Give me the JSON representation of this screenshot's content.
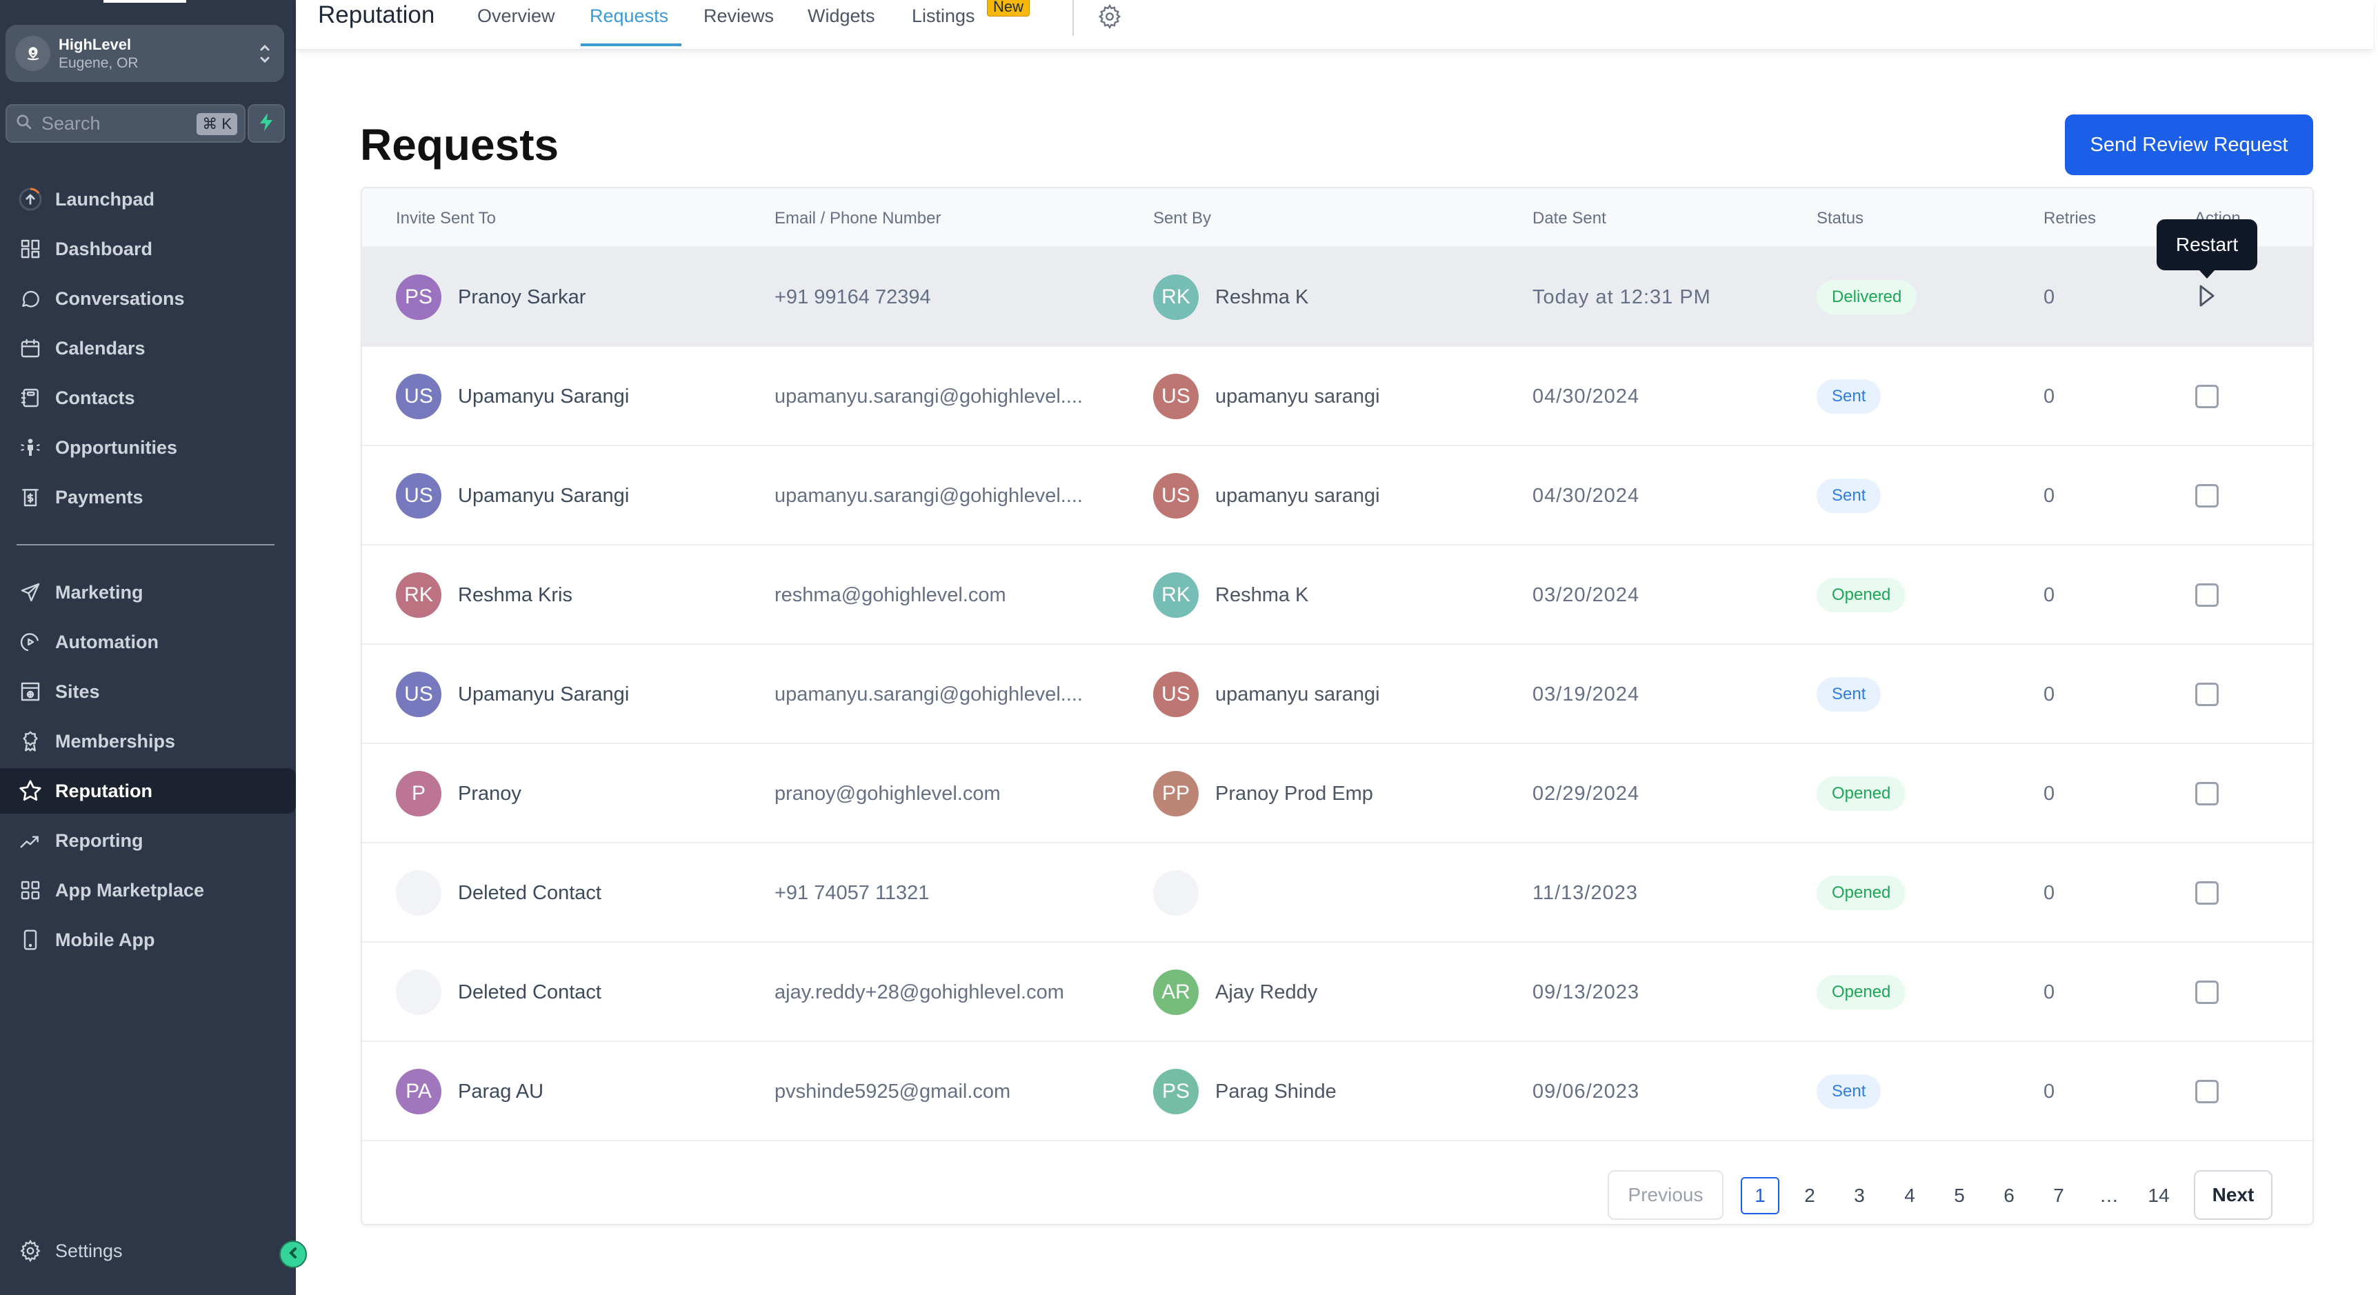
{
  "sidebar": {
    "account": {
      "name": "HighLevel",
      "location": "Eugene, OR"
    },
    "search": {
      "placeholder": "Search",
      "shortcut": "⌘ K"
    },
    "items": [
      {
        "label": "Launchpad",
        "icon": "launchpad-icon"
      },
      {
        "label": "Dashboard",
        "icon": "dashboard-icon"
      },
      {
        "label": "Conversations",
        "icon": "chat-icon"
      },
      {
        "label": "Calendars",
        "icon": "calendar-icon"
      },
      {
        "label": "Contacts",
        "icon": "contacts-icon"
      },
      {
        "label": "Opportunities",
        "icon": "opportunities-icon"
      },
      {
        "label": "Payments",
        "icon": "payments-icon"
      },
      {
        "label": "Marketing",
        "icon": "send-icon"
      },
      {
        "label": "Automation",
        "icon": "automation-icon"
      },
      {
        "label": "Sites",
        "icon": "sites-icon"
      },
      {
        "label": "Memberships",
        "icon": "membership-icon"
      },
      {
        "label": "Reputation",
        "icon": "star-icon",
        "active": true
      },
      {
        "label": "Reporting",
        "icon": "trending-icon"
      },
      {
        "label": "App Marketplace",
        "icon": "apps-grid-icon"
      },
      {
        "label": "Mobile App",
        "icon": "mobile-icon"
      }
    ],
    "settings_label": "Settings"
  },
  "topnav": {
    "title": "Reputation",
    "tabs": [
      {
        "label": "Overview"
      },
      {
        "label": "Requests",
        "active": true
      },
      {
        "label": "Reviews"
      },
      {
        "label": "Widgets"
      },
      {
        "label": "Listings",
        "badge": "New"
      }
    ]
  },
  "main": {
    "title": "Requests",
    "send_button": "Send Review Request",
    "tooltip": "Restart",
    "columns": [
      "Invite Sent To",
      "Email / Phone Number",
      "Sent By",
      "Date Sent",
      "Status",
      "Retries",
      "Action"
    ],
    "rows": [
      {
        "invitee": "Pranoy Sarkar",
        "invitee_initials": "PS",
        "invitee_color": "#9b72bf",
        "contact": "+91 99164 72394",
        "sender": "Reshma K",
        "sender_initials": "RK",
        "sender_color": "#76bdb6",
        "date": "Today at 12:31 PM",
        "status": "Delivered",
        "retries": "0",
        "action": "restart"
      },
      {
        "invitee": "Upamanyu Sarangi",
        "invitee_initials": "US",
        "invitee_color": "#7679bd",
        "contact": "upamanyu.sarangi@gohighlevel....",
        "sender": "upamanyu sarangi",
        "sender_initials": "US",
        "sender_color": "#bd7672",
        "date": "04/30/2024",
        "status": "Sent",
        "retries": "0",
        "action": "checkbox"
      },
      {
        "invitee": "Upamanyu Sarangi",
        "invitee_initials": "US",
        "invitee_color": "#7679bd",
        "contact": "upamanyu.sarangi@gohighlevel....",
        "sender": "upamanyu sarangi",
        "sender_initials": "US",
        "sender_color": "#bd7672",
        "date": "04/30/2024",
        "status": "Sent",
        "retries": "0",
        "action": "checkbox"
      },
      {
        "invitee": "Reshma Kris",
        "invitee_initials": "RK",
        "invitee_color": "#bd7282",
        "contact": "reshma@gohighlevel.com",
        "sender": "Reshma K",
        "sender_initials": "RK",
        "sender_color": "#76bdb6",
        "date": "03/20/2024",
        "status": "Opened",
        "retries": "0",
        "action": "checkbox"
      },
      {
        "invitee": "Upamanyu Sarangi",
        "invitee_initials": "US",
        "invitee_color": "#7679bd",
        "contact": "upamanyu.sarangi@gohighlevel....",
        "sender": "upamanyu sarangi",
        "sender_initials": "US",
        "sender_color": "#bd7672",
        "date": "03/19/2024",
        "status": "Sent",
        "retries": "0",
        "action": "checkbox"
      },
      {
        "invitee": "Pranoy",
        "invitee_initials": "P",
        "invitee_color": "#bd7596",
        "contact": "pranoy@gohighlevel.com",
        "sender": "Pranoy Prod Emp",
        "sender_initials": "PP",
        "sender_color": "#bd8575",
        "date": "02/29/2024",
        "status": "Opened",
        "retries": "0",
        "action": "checkbox"
      },
      {
        "invitee": "Deleted Contact",
        "invitee_initials": "",
        "invitee_color": "",
        "contact": "+91 74057 11321",
        "sender": "",
        "sender_initials": "",
        "sender_color": "",
        "date": "11/13/2023",
        "status": "Opened",
        "retries": "0",
        "action": "checkbox"
      },
      {
        "invitee": "Deleted Contact",
        "invitee_initials": "",
        "invitee_color": "",
        "contact": "ajay.reddy+28@gohighlevel.com",
        "sender": "Ajay Reddy",
        "sender_initials": "AR",
        "sender_color": "#76bd7c",
        "date": "09/13/2023",
        "status": "Opened",
        "retries": "0",
        "action": "checkbox"
      },
      {
        "invitee": "Parag AU",
        "invitee_initials": "PA",
        "invitee_color": "#a076bd",
        "contact": "pvshinde5925@gmail.com",
        "sender": "Parag Shinde",
        "sender_initials": "PS",
        "sender_color": "#76bda6",
        "date": "09/06/2023",
        "status": "Sent",
        "retries": "0",
        "action": "checkbox"
      }
    ],
    "pagination": {
      "previous": "Previous",
      "next": "Next",
      "pages": [
        "1",
        "2",
        "3",
        "4",
        "5",
        "6",
        "7",
        "…",
        "14"
      ],
      "current": "1"
    }
  },
  "colors": {
    "accent": "#1b5fe8",
    "tab_active": "#3b9bd6",
    "sidebar_bg": "#2d3748",
    "new_badge": "#f5b80b"
  }
}
